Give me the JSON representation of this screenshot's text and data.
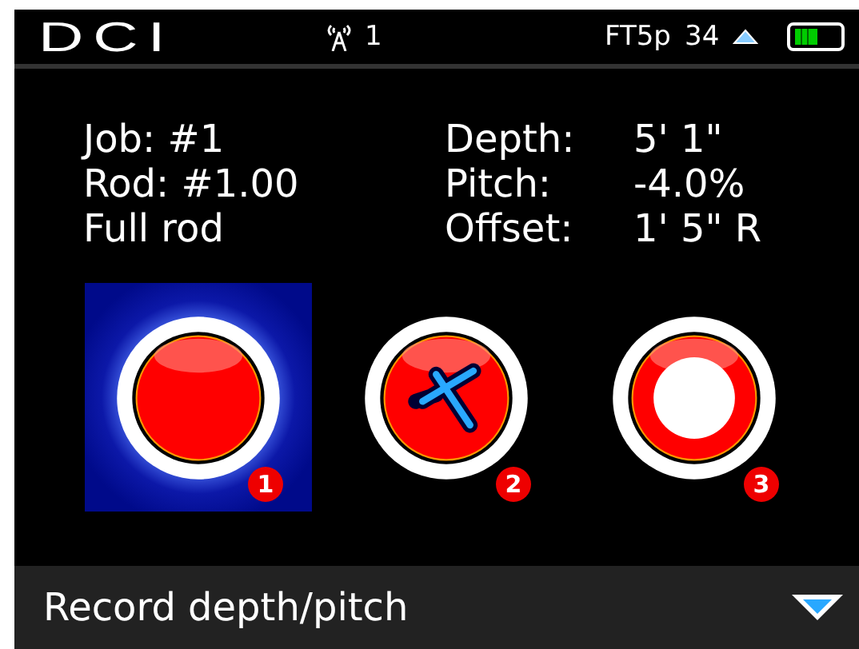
{
  "status_bar": {
    "logo": "DCI",
    "channel": "1",
    "frequency": "FT5p",
    "count": "34"
  },
  "info": {
    "left": [
      "Job: #1",
      "Rod: #1.00",
      "Full rod"
    ],
    "right": [
      {
        "label": "Depth:",
        "value": "5' 1\""
      },
      {
        "label": "Pitch:",
        "value": "-4.0%"
      },
      {
        "label": "Offset:",
        "value": "1' 5\" R"
      }
    ]
  },
  "buttons": [
    {
      "kind": "record",
      "badge": "1",
      "selected": true
    },
    {
      "kind": "locator",
      "badge": "2",
      "selected": false
    },
    {
      "kind": "stop",
      "badge": "3",
      "selected": false
    }
  ],
  "footer": {
    "label": "Record depth/pitch"
  }
}
